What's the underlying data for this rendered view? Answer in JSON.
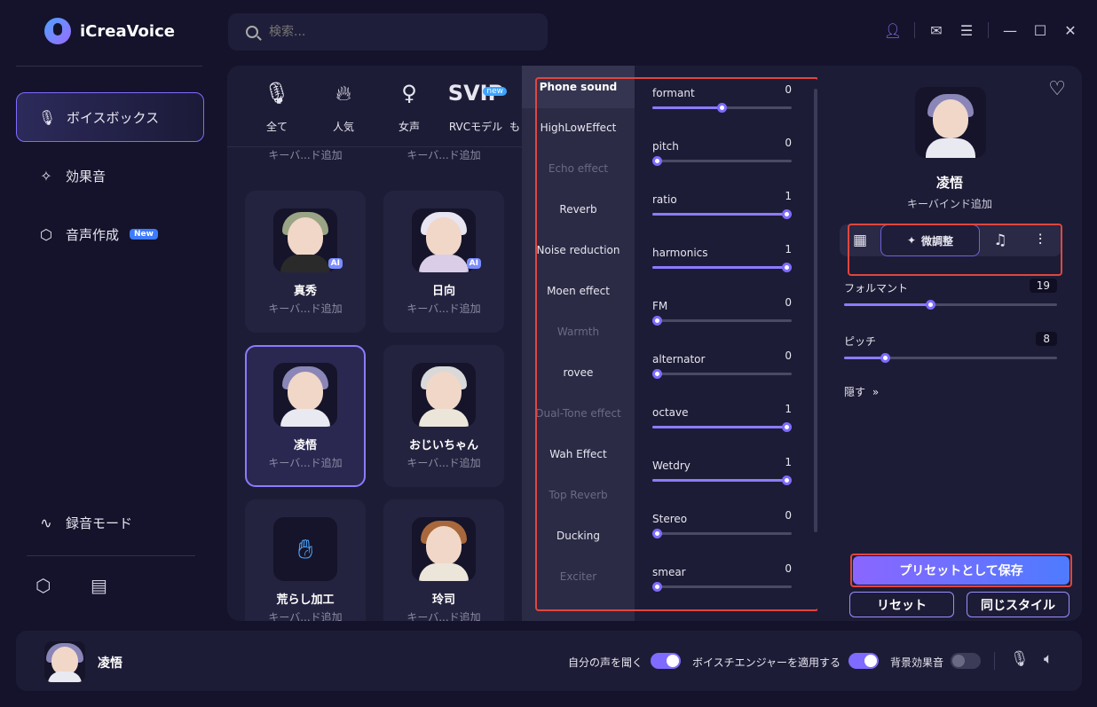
{
  "app": {
    "title": "iCreaVoice"
  },
  "search": {
    "placeholder": "検索..."
  },
  "sidebar": {
    "items": [
      {
        "label": "ボイスボックス",
        "icon": "mic-icon",
        "active": true
      },
      {
        "label": "効果音",
        "icon": "sparkle-icon"
      },
      {
        "label": "音声作成",
        "icon": "cube-icon",
        "badge": "New"
      },
      {
        "label": "録音モード",
        "icon": "waveform-icon"
      }
    ]
  },
  "categories": [
    {
      "label": "全て",
      "icon": "mic-icon"
    },
    {
      "label": "人気",
      "icon": "flame-icon"
    },
    {
      "label": "女声",
      "icon": "female-icon"
    },
    {
      "label": "RVCモデル",
      "icon": "svip-icon",
      "icon_text": "SVIP",
      "badge": "new"
    },
    {
      "label": "も",
      "icon": ""
    }
  ],
  "voices": [
    {
      "name": "",
      "sub": "キーバ...ド追加"
    },
    {
      "name": "",
      "sub": "キーバ...ド追加"
    },
    {
      "name": "真秀",
      "sub": "キーバ...ド追加",
      "ai": "AI"
    },
    {
      "name": "日向",
      "sub": "キーバ...ド追加",
      "ai": "AI"
    },
    {
      "name": "凌悟",
      "sub": "キーバ...ド追加",
      "selected": true
    },
    {
      "name": "おじいちゃん",
      "sub": "キーバ...ド追加"
    },
    {
      "name": "荒らし加工",
      "sub": "キーバ...ド追加"
    },
    {
      "name": "玲司",
      "sub": "キーバ...ド追加"
    }
  ],
  "effects": [
    {
      "label": "Phone sound",
      "state": "active"
    },
    {
      "label": "HighLowEffect",
      "state": "normal"
    },
    {
      "label": "Echo effect",
      "state": "dim"
    },
    {
      "label": "Reverb",
      "state": "normal"
    },
    {
      "label": "Noise reduction",
      "state": "normal"
    },
    {
      "label": "Moen effect",
      "state": "normal"
    },
    {
      "label": "Warmth",
      "state": "dim"
    },
    {
      "label": "rovee",
      "state": "normal"
    },
    {
      "label": "Dual-Tone effect",
      "state": "dim"
    },
    {
      "label": "Wah Effect",
      "state": "normal"
    },
    {
      "label": "Top Reverb",
      "state": "dim"
    },
    {
      "label": "Ducking",
      "state": "normal"
    },
    {
      "label": "Exciter",
      "state": "dim"
    }
  ],
  "params": [
    {
      "label": "formant",
      "value": "0",
      "fraction": 0.5
    },
    {
      "label": "pitch",
      "value": "0",
      "fraction": 0.0
    },
    {
      "label": "ratio",
      "value": "1",
      "fraction": 1.0
    },
    {
      "label": "harmonics",
      "value": "1",
      "fraction": 1.0
    },
    {
      "label": "FM",
      "value": "0",
      "fraction": 0.0
    },
    {
      "label": "alternator",
      "value": "0",
      "fraction": 0.0
    },
    {
      "label": "octave",
      "value": "1",
      "fraction": 1.0
    },
    {
      "label": "Wetdry",
      "value": "1",
      "fraction": 1.0
    },
    {
      "label": "Stereo",
      "value": "0",
      "fraction": 0.0
    },
    {
      "label": "smear",
      "value": "0",
      "fraction": 0.0
    }
  ],
  "detail": {
    "name": "凌悟",
    "sub": "キーバインド追加",
    "tabs": [
      {
        "label": "",
        "icon": "grid-icon"
      },
      {
        "label": "微調整",
        "icon": "magic-wand-icon",
        "active": true
      },
      {
        "label": "",
        "icon": "music-note-icon"
      },
      {
        "label": "",
        "icon": "equalizer-icon"
      }
    ],
    "sliders": [
      {
        "label": "フォルマント",
        "value": "19",
        "fraction": 0.4
      },
      {
        "label": "ピッチ",
        "value": "8",
        "fraction": 0.18
      }
    ],
    "hide_label": "隠す",
    "save_label": "プリセットとして保存",
    "reset_label": "リセット",
    "same_style_label": "同じスタイル"
  },
  "bottom": {
    "name": "凌悟",
    "listen_label": "自分の声を聞く",
    "listen_on": true,
    "apply_label": "ボイスチエンジャーを適用する",
    "apply_on": true,
    "bg_label": "背景効果音",
    "bg_on": false
  },
  "colors": {
    "accent": "#7f6bff",
    "highlight": "#e0463f",
    "background": "#14132b"
  }
}
